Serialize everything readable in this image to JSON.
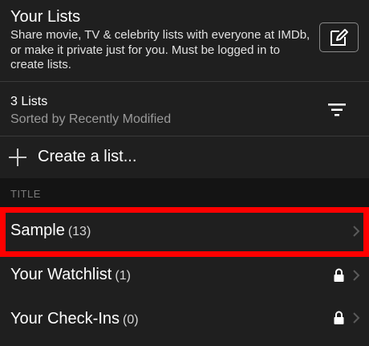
{
  "header": {
    "title": "Your Lists",
    "description": "Share movie, TV & celebrity lists with everyone at IMDb, or make it private just for you. Must be logged in to create lists.",
    "edit_icon": "edit-icon"
  },
  "summary": {
    "count_text": "3 Lists",
    "sort_text": "Sorted by Recently Modified",
    "sort_icon": "sort-icon"
  },
  "create": {
    "label": "Create a list...",
    "icon": "plus-icon"
  },
  "section": {
    "label": "TITLE"
  },
  "lists": [
    {
      "name": "Sample",
      "count": "(13)",
      "locked": false
    },
    {
      "name": "Your Watchlist",
      "count": "(1)",
      "locked": true
    },
    {
      "name": "Your Check-Ins",
      "count": "(0)",
      "locked": true
    }
  ],
  "colors": {
    "background": "#1f1f1f",
    "section_background": "#141414",
    "highlight": "#ff0000",
    "muted_text": "#9a9a9a"
  }
}
